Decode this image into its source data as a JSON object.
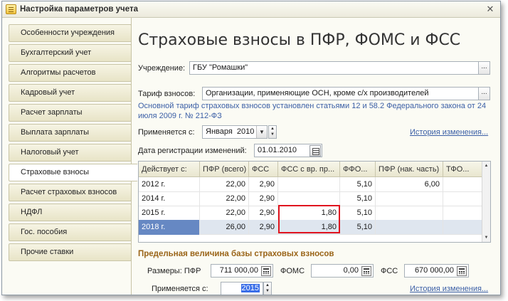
{
  "window": {
    "title": "Настройка параметров учета"
  },
  "sidebar": {
    "items": [
      {
        "label": "Особенности учреждения"
      },
      {
        "label": "Бухгалтерский учет"
      },
      {
        "label": "Алгоритмы расчетов"
      },
      {
        "label": "Кадровый учет"
      },
      {
        "label": "Расчет зарплаты"
      },
      {
        "label": "Выплата зарплаты"
      },
      {
        "label": "Налоговый учет"
      },
      {
        "label": "Страховые взносы",
        "active": true
      },
      {
        "label": "Расчет страховых взносов"
      },
      {
        "label": "НДФЛ"
      },
      {
        "label": "Гос. пособия"
      },
      {
        "label": "Прочие ставки"
      }
    ]
  },
  "main": {
    "title": "Страховые взносы в ПФР, ФОМС и ФСС",
    "institution": {
      "label": "Учреждение:",
      "value": "ГБУ \"Ромашки\"",
      "button": "..."
    },
    "tariff": {
      "label": "Тариф взносов:",
      "value": "Организации, применяющие ОСН, кроме с/х производителей",
      "button": "..."
    },
    "note": "Основной тариф страховых взносов установлен статьями 12 и 58.2 Федерального закона от 24 июля 2009 г. № 212-ФЗ",
    "applies_from": {
      "label": "Применяется с:",
      "value": "Января  2010",
      "dropdown": "▼"
    },
    "history_link": "История изменения...",
    "reg_date": {
      "label": "Дата регистрации изменений:",
      "value": "01.01.2010"
    },
    "grid": {
      "headers": [
        "Действует с:",
        "ПФР (всего)",
        "ФСС",
        "ФСС с вр. пр...",
        "ФФО...",
        "ПФР (нак. часть)",
        "ТФО..."
      ],
      "rows": [
        [
          "2012 г.",
          "22,00",
          "2,90",
          "",
          "5,10",
          "6,00",
          ""
        ],
        [
          "2014 г.",
          "22,00",
          "2,90",
          "",
          "5,10",
          "",
          ""
        ],
        [
          "2015 г.",
          "22,00",
          "2,90",
          "1,80",
          "5,10",
          "",
          ""
        ],
        [
          "2018 г.",
          "26,00",
          "2,90",
          "1,80",
          "5,10",
          "",
          ""
        ]
      ],
      "selected_row": 3
    },
    "limits": {
      "heading": "Предельная величина базы страховых взносов",
      "sizes_label": "Размеры: ПФР",
      "pfr_value": "711 000,00",
      "foms_label": "ФОМС",
      "foms_value": "0,00",
      "fss_label": "ФСС",
      "fss_value": "670 000,00",
      "applies_label": "Применяется с:",
      "year_value": "2015",
      "history_link": "История изменения..."
    }
  },
  "colors": {
    "highlight": "#e0141f",
    "link": "#3b5fa6",
    "section_head": "#9a6418",
    "selection": "#6688c3"
  }
}
